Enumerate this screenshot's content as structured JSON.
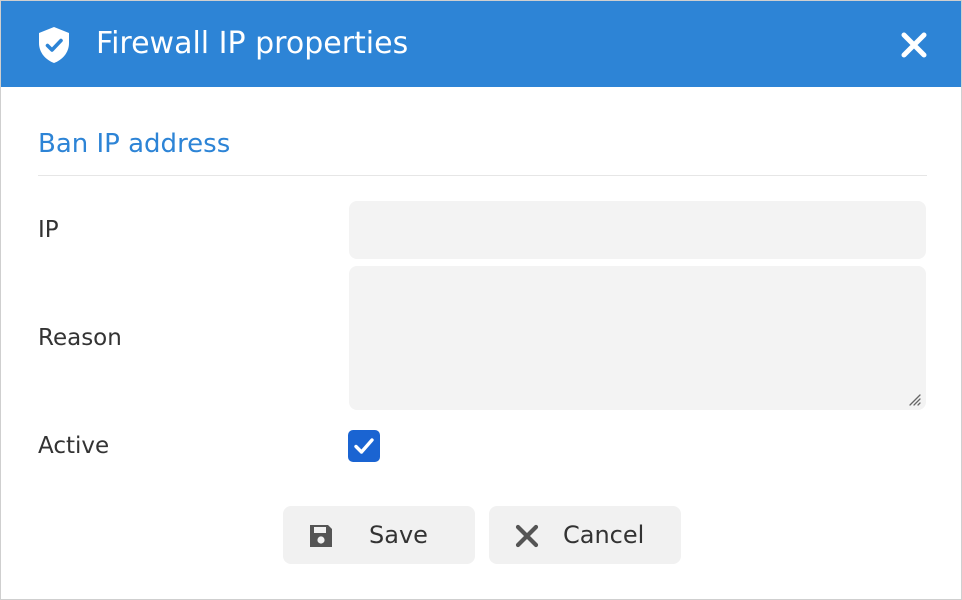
{
  "dialog": {
    "title": "Firewall IP properties",
    "title_icon": "shield-check-icon",
    "close_icon": "close-icon"
  },
  "section": {
    "title": "Ban IP address"
  },
  "form": {
    "ip": {
      "label": "IP",
      "value": ""
    },
    "reason": {
      "label": "Reason",
      "value": ""
    },
    "active": {
      "label": "Active",
      "checked": true
    }
  },
  "buttons": {
    "save": {
      "label": "Save",
      "icon": "floppy-disk-icon"
    },
    "cancel": {
      "label": "Cancel",
      "icon": "x-icon"
    }
  },
  "colors": {
    "titlebar": "#2d84d6",
    "accent": "#2d84d6",
    "checkbox": "#1a64d2",
    "field_bg": "#f3f3f3",
    "button_bg": "#f1f1f1"
  }
}
